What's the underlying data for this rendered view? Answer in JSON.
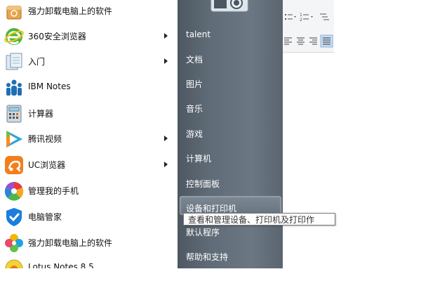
{
  "programs": [
    {
      "label": "强力卸载电脑上的软件",
      "icon": "uninstall-box-icon",
      "arrow": false
    },
    {
      "label": "360安全浏览器",
      "icon": "browser-360-icon",
      "arrow": true
    },
    {
      "label": "入门",
      "icon": "getting-started-icon",
      "arrow": true
    },
    {
      "label": "IBM Notes",
      "icon": "ibm-notes-icon",
      "arrow": false
    },
    {
      "label": "计算器",
      "icon": "calculator-icon",
      "arrow": false
    },
    {
      "label": "腾讯视频",
      "icon": "tencent-video-icon",
      "arrow": true
    },
    {
      "label": "UC浏览器",
      "icon": "uc-browser-icon",
      "arrow": true
    },
    {
      "label": "管理我的手机",
      "icon": "phone-manager-icon",
      "arrow": false
    },
    {
      "label": "电脑管家",
      "icon": "pc-manager-icon",
      "arrow": false
    },
    {
      "label": "强力卸载电脑上的软件",
      "icon": "uninstall-clover-icon",
      "arrow": false
    },
    {
      "label": "Lotus Notes 8.5",
      "icon": "lotus-notes-icon",
      "arrow": false
    }
  ],
  "right_panel": {
    "items": [
      {
        "label": "talent"
      },
      {
        "label": "文档"
      },
      {
        "label": "图片"
      },
      {
        "label": "音乐"
      },
      {
        "label": "游戏"
      },
      {
        "label": "计算机"
      },
      {
        "label": "控制面板"
      },
      {
        "label": "设备和打印机"
      },
      {
        "label": "默认程序"
      },
      {
        "label": "帮助和支持"
      }
    ],
    "highlighted": "设备和打印机"
  },
  "tooltip": {
    "text": "查看和管理设备、打印机及打印作"
  },
  "colors": {
    "panel": "#5f6b76",
    "arrow": "#222222",
    "tooltip_border": "#767676"
  }
}
